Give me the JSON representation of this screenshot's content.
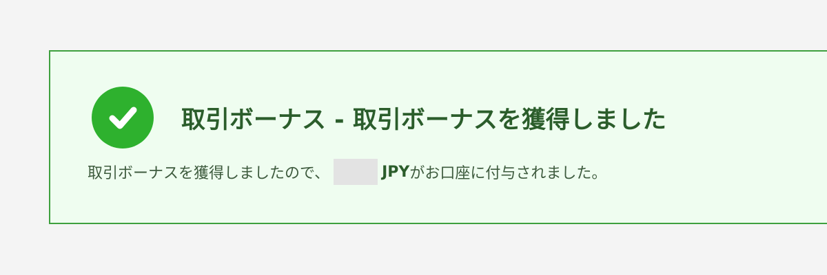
{
  "alert": {
    "title": "取引ボーナス - 取引ボーナスを獲得しました",
    "message_before": "取引ボーナスを獲得しましたので、",
    "amount": "",
    "currency": "JPY",
    "message_after": "がお口座に付与されました。",
    "icon": "check-circle-icon"
  },
  "colors": {
    "background": "#f4f4f4",
    "alert_background": "#effdf0",
    "alert_border": "#3ea03e",
    "icon": "#2eb12e",
    "title_text": "#2b5d2b",
    "body_text": "#3d5a3d",
    "amount_box": "#e3e3e3"
  }
}
